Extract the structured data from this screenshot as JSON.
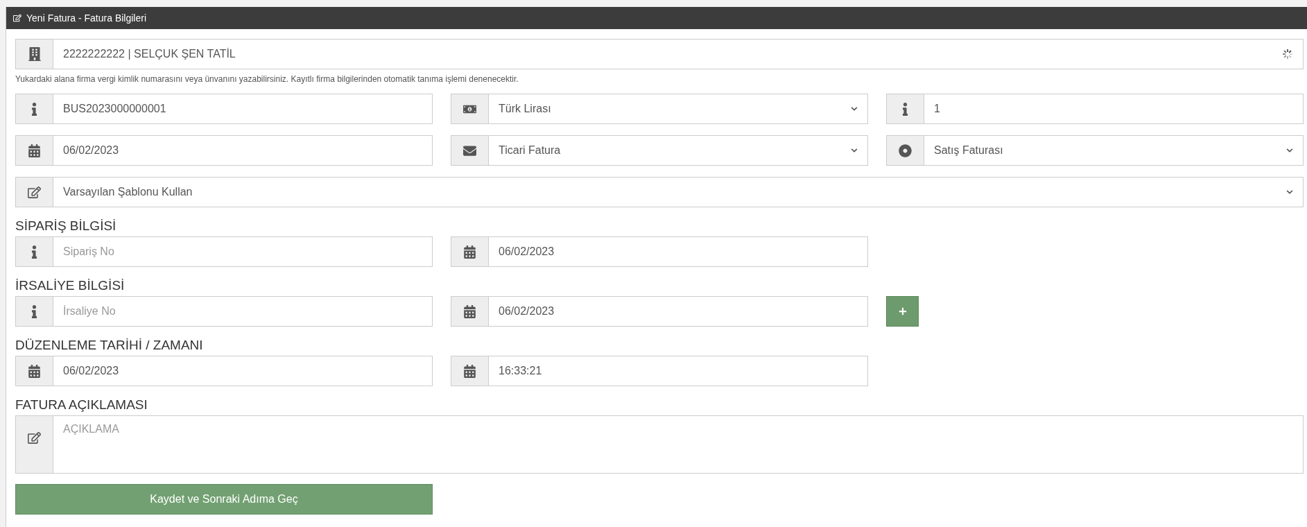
{
  "panel": {
    "title": "Yeni Fatura - Fatura Bilgileri"
  },
  "company": {
    "value": "2222222222 | SELÇUK ŞEN TATİL",
    "loading": true
  },
  "hint": "Yukardaki alana firma vergi kimlik numarasını veya ünvanını yazabilirsiniz. Kayıtlı firma bilgilerinden otomatik tanıma işlemi denenecektir.",
  "main_rows": [
    [
      {
        "kind": "input",
        "value": "BUS2023000000001"
      },
      {
        "kind": "select",
        "value": "Türk Lirası"
      },
      {
        "kind": "input",
        "value": "1"
      }
    ],
    [
      {
        "kind": "input",
        "value": "06/02/2023"
      },
      {
        "kind": "select",
        "value": "Ticari Fatura"
      },
      {
        "kind": "select",
        "value": "Satış Faturası"
      }
    ],
    [
      {
        "kind": "select",
        "value": "Varsayılan Şablonu Kullan"
      }
    ]
  ],
  "sections": [
    {
      "title": "SİPARİŞ BİLGİSİ",
      "fields": [
        {
          "placeholder": "Sipariş No"
        },
        {
          "value": "06/02/2023"
        }
      ],
      "add_button": false
    },
    {
      "title": "İRSALİYE BİLGİSİ",
      "fields": [
        {
          "placeholder": "İrsaliye No"
        },
        {
          "value": "06/02/2023"
        }
      ],
      "add_button": true
    },
    {
      "title": "DÜZENLEME TARİHİ / ZAMANI",
      "fields": [
        {
          "value": "06/02/2023"
        },
        {
          "value": "16:33:21"
        }
      ],
      "add_button": false
    }
  ],
  "description": {
    "title": "FATURA AÇIKLAMASI",
    "placeholder": "AÇIKLAMA"
  },
  "submit": "Kaydet ve Sonraki Adıma Geç"
}
